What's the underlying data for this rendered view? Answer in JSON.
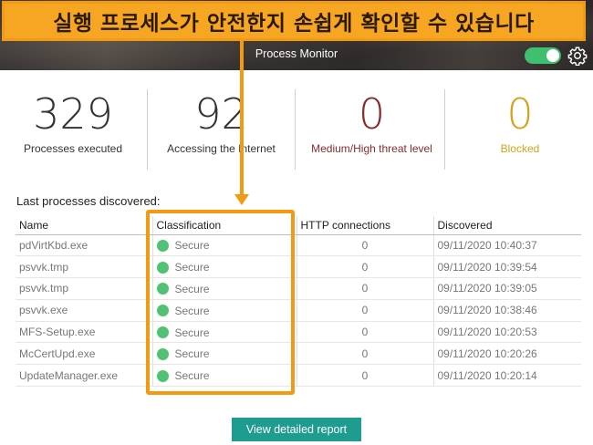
{
  "banner": {
    "text": "실행 프로세스가 안전한지 손쉽게 확인할 수 있습니다"
  },
  "app": {
    "title": "Process Monitor",
    "toggle_on": true
  },
  "stats": [
    {
      "value": "329",
      "label": "Processes executed",
      "color": "#222222"
    },
    {
      "value": "92",
      "label": "Accessing the Internet",
      "color": "#222222"
    },
    {
      "value": "0",
      "label": "Medium/High threat level",
      "color": "#8b2a2a"
    },
    {
      "value": "0",
      "label": "Blocked",
      "color": "#d4a21c"
    }
  ],
  "section": {
    "title": "Last processes discovered:"
  },
  "table": {
    "headers": [
      "Name",
      "Classification",
      "HTTP connections",
      "Discovered"
    ],
    "rows": [
      {
        "name": "pdVirtKbd.exe",
        "classification": "Secure",
        "http": "0",
        "discovered": "09/11/2020 10:40:37"
      },
      {
        "name": "psvvk.tmp",
        "classification": "Secure",
        "http": "0",
        "discovered": "09/11/2020 10:39:54"
      },
      {
        "name": "psvvk.tmp",
        "classification": "Secure",
        "http": "0",
        "discovered": "09/11/2020 10:39:05"
      },
      {
        "name": "psvvk.exe",
        "classification": "Secure",
        "http": "0",
        "discovered": "09/11/2020 10:38:46"
      },
      {
        "name": "MFS-Setup.exe",
        "classification": "Secure",
        "http": "0",
        "discovered": "09/11/2020 10:20:53"
      },
      {
        "name": "McCertUpd.exe",
        "classification": "Secure",
        "http": "0",
        "discovered": "09/11/2020 10:20:26"
      },
      {
        "name": "UpdateManager.exe",
        "classification": "Secure",
        "http": "0",
        "discovered": "09/11/2020 10:20:14"
      }
    ]
  },
  "button": {
    "report_label": "View detailed report"
  },
  "colors": {
    "accent_orange": "#f39a12",
    "secure_green": "#4fc273",
    "button_teal": "#1d9c8f"
  }
}
